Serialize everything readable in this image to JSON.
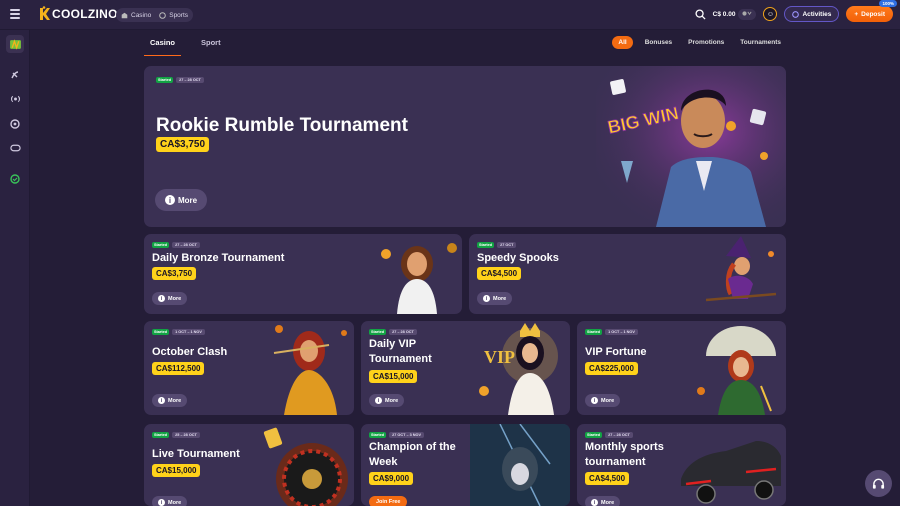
{
  "header": {
    "logo": "COOLZINO",
    "nav": [
      {
        "label": "Casino",
        "icon": "casino-icon"
      },
      {
        "label": "Sports",
        "icon": "sports-icon"
      }
    ],
    "balance": "C$ 0.00",
    "activities": "Activities",
    "deposit": "Deposit",
    "deposit_badge": "100%"
  },
  "sidebar": {
    "items": [
      "game-icon",
      "sport-icon",
      "live-icon",
      "football-icon",
      "esports-icon",
      "bonus-icon"
    ]
  },
  "tabs": [
    {
      "label": "Casino",
      "active": true
    },
    {
      "label": "Sport",
      "active": false
    }
  ],
  "filters": [
    {
      "label": "All",
      "active": true
    },
    {
      "label": "Bonuses",
      "active": false
    },
    {
      "label": "Promotions",
      "active": false
    },
    {
      "label": "Tournaments",
      "active": false
    }
  ],
  "cards": [
    {
      "status": "Started",
      "dates": "27 – 28 OCT",
      "title": "Rookie Rumble Tournament",
      "prize": "CA$3,750",
      "action": "More"
    },
    {
      "status": "Started",
      "dates": "27 – 28 OCT",
      "title": "Daily Bronze Tournament",
      "prize": "CA$3,750",
      "action": "More"
    },
    {
      "status": "Started",
      "dates": "27 OCT",
      "title": "Speedy Spooks",
      "prize": "CA$4,500",
      "action": "More"
    },
    {
      "status": "Started",
      "dates": "1 OCT – 1 NOV",
      "title": "October Clash",
      "prize": "CA$112,500",
      "action": "More"
    },
    {
      "status": "Started",
      "dates": "27 – 28 OCT",
      "title": "Daily VIP",
      "title2": "Tournament",
      "prize": "CA$15,000",
      "action": "More"
    },
    {
      "status": "Started",
      "dates": "1 OCT – 1 NOV",
      "title": "VIP Fortune",
      "prize": "CA$225,000",
      "action": "More"
    },
    {
      "status": "Started",
      "dates": "25 – 28 OCT",
      "title": "Live Tournament",
      "prize": "CA$15,000",
      "action": "More"
    },
    {
      "status": "Started",
      "dates": "27 OCT – 3 NOV",
      "title": "Champion of the",
      "title2": "Week",
      "prize": "CA$9,000",
      "action": "Join Free"
    },
    {
      "status": "Started",
      "dates": "27 – 28 OCT",
      "title": "Monthly sports",
      "title2": "tournament",
      "prize": "CA$4,500",
      "action": "More"
    }
  ],
  "art": {
    "big_win": "BIG WIN",
    "vip": "VIP"
  },
  "colors": {
    "accent": "#f36b12",
    "prize": "#ffd21a",
    "started": "#12a344",
    "card": "#3a3053"
  }
}
